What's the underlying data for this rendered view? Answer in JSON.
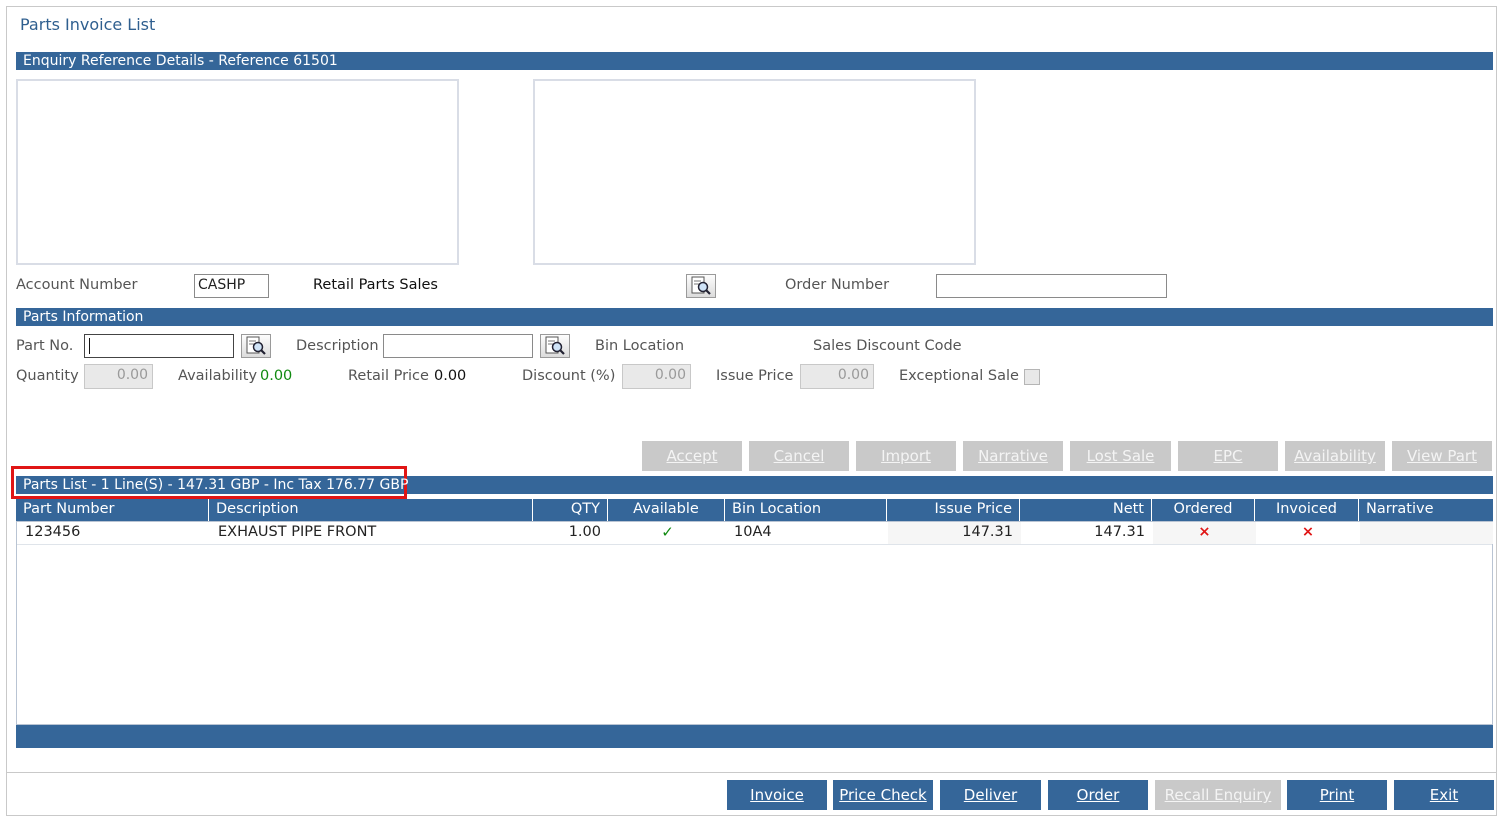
{
  "page_title": "Parts Invoice List",
  "enquiry_bar": "Enquiry Reference Details  -  Reference 61501",
  "account": {
    "label": "Account Number",
    "value": "CASHP",
    "name": "Retail Parts Sales",
    "order_label": "Order Number",
    "order_value": ""
  },
  "parts_info_bar": "Parts Information",
  "parts_info": {
    "part_no_label": "Part No.",
    "part_no_value": "",
    "description_label": "Description",
    "description_value": "",
    "bin_location_label": "Bin Location",
    "sales_discount_code_label": "Sales Discount Code",
    "quantity_label": "Quantity",
    "quantity_value": "0.00",
    "availability_label": "Availability",
    "availability_value": "0.00",
    "retail_price_label": "Retail Price",
    "retail_price_value": "0.00",
    "discount_label": "Discount (%)",
    "discount_value": "0.00",
    "issue_price_label": "Issue Price",
    "issue_price_value": "0.00",
    "exceptional_sale_label": "Exceptional Sale",
    "exceptional_sale_checked": false
  },
  "action_buttons": [
    "Accept",
    "Cancel",
    "Import",
    "Narrative",
    "Lost Sale",
    "EPC",
    "Availability",
    "View Part"
  ],
  "parts_list_bar": "Parts List - 1 Line(S) - 147.31 GBP - Inc Tax 176.77 GBP",
  "grid": {
    "columns": [
      "Part Number",
      "Description",
      "QTY",
      "Available",
      "Bin Location",
      "Issue Price",
      "Nett",
      "Ordered",
      "Invoiced",
      "Narrative"
    ],
    "rows": [
      {
        "part_number": "123456",
        "description": "EXHAUST PIPE FRONT",
        "qty": "1.00",
        "available": "✓",
        "bin_location": "10A4",
        "issue_price": "147.31",
        "nett": "147.31",
        "ordered": "×",
        "invoiced": "×",
        "narrative": ""
      }
    ]
  },
  "bottom_buttons": [
    "Invoice",
    "Price Check",
    "Deliver",
    "Order",
    "Recall Enquiry",
    "Print",
    "Exit"
  ],
  "colors": {
    "header_blue": "#356699",
    "disabled_button": "#c9c9c9",
    "available_green": "#108a10",
    "flag_red": "#e01515",
    "highlight_red": "#e01515"
  },
  "icons": {
    "lookup": "magnifier-document-icon",
    "available": "checkmark-icon",
    "not_ordered": "red-x-icon"
  }
}
